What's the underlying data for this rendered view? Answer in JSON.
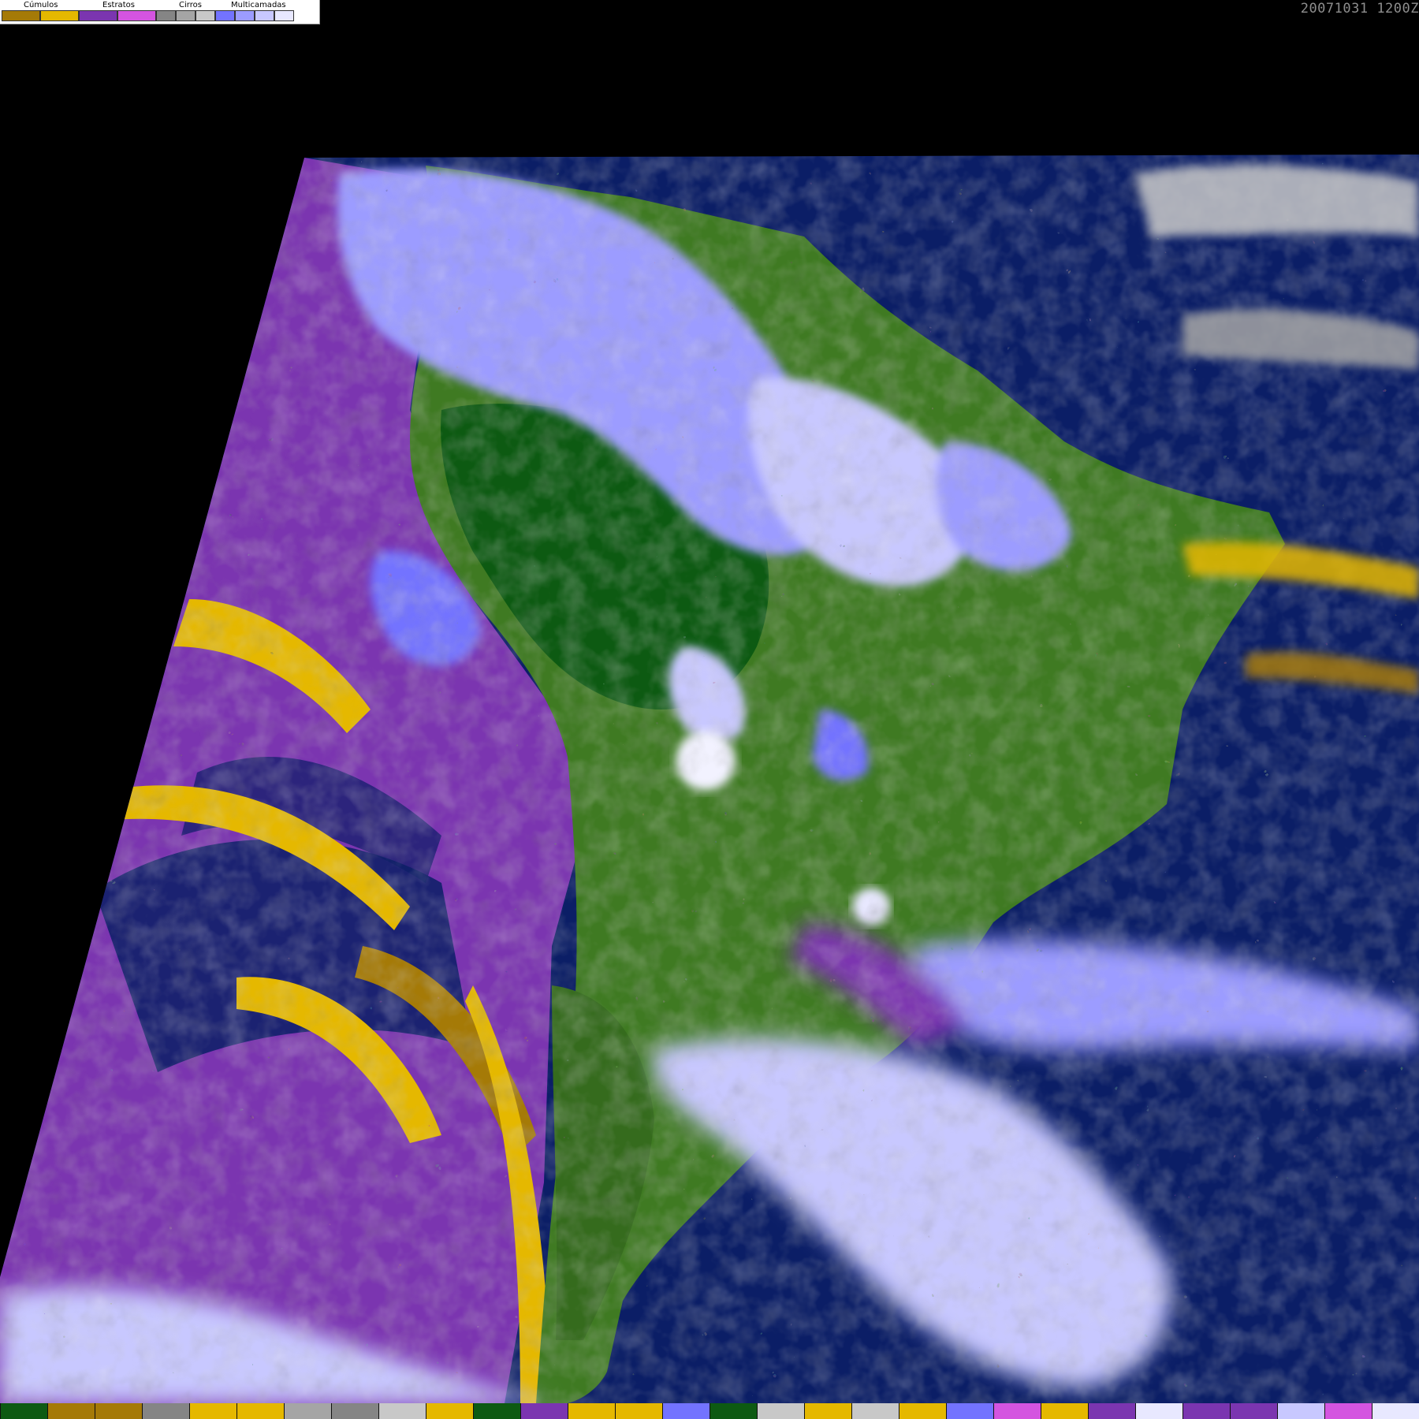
{
  "timestamp": "20071031 1200Z",
  "legend": {
    "groups": [
      {
        "label": "Cúmulos",
        "swatches": [
          "#a57a07",
          "#e5b800"
        ]
      },
      {
        "label": "Estratos",
        "swatches": [
          "#7b35b0",
          "#d454e0"
        ]
      },
      {
        "label": "Cirros",
        "swatches": [
          "#858585",
          "#a5a5a5",
          "#c8c8c8"
        ]
      },
      {
        "label": "Multicamadas",
        "swatches": [
          "#7373ff",
          "#9c9cff",
          "#c8c8ff",
          "#e8e8ff"
        ]
      }
    ]
  },
  "colors": {
    "background": "#000000",
    "ocean": "#0b1e66",
    "land_dark": "#0d5a12",
    "land": "#3f7a22",
    "stratus": "#7b35b0",
    "cumulus": "#e5b800",
    "cumulus_dark": "#a57a07",
    "multilayer": "#7373ff",
    "multilayer_light": "#c8c8ff",
    "cirrus": "#a5a5a5"
  },
  "bottom_strip": [
    "#0d5a12",
    "#a57a07",
    "#a57a07",
    "#858585",
    "#e5b800",
    "#e5b800",
    "#a5a5a5",
    "#858585",
    "#c8c8c8",
    "#e5b800",
    "#0d5a12",
    "#7b35b0",
    "#e5b800",
    "#e5b800",
    "#7373ff",
    "#0d5a12",
    "#c8c8c8",
    "#e5b800",
    "#c8c8c8",
    "#e5b800",
    "#7373ff",
    "#d454e0",
    "#e5b800",
    "#7b35b0",
    "#e8e8ff",
    "#7b35b0",
    "#7b35b0",
    "#c8c8ff",
    "#d454e0",
    "#e8e8ff"
  ]
}
